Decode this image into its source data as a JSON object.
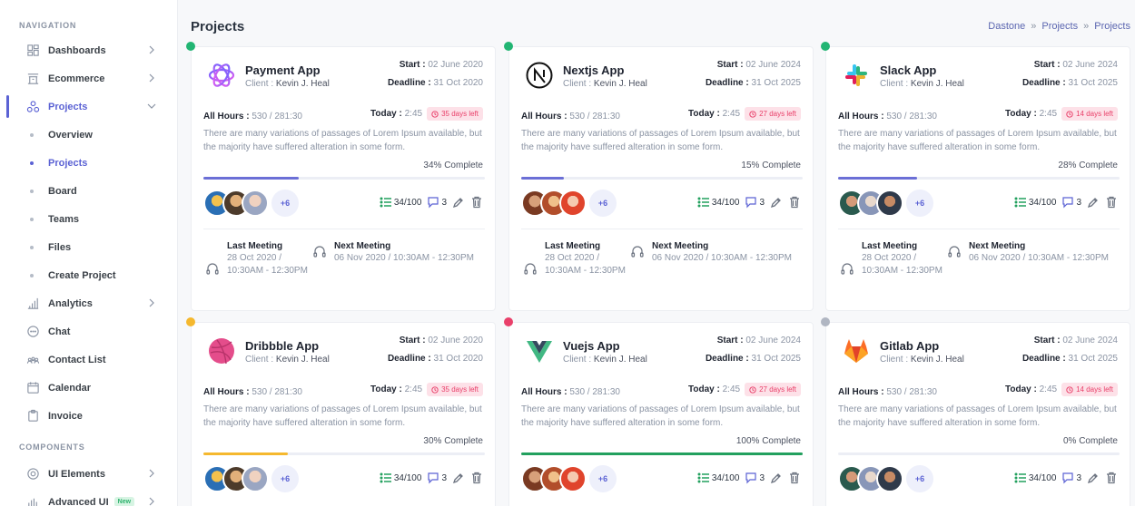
{
  "sidebar": {
    "navigation_title": "NAVIGATION",
    "components_title": "COMPONENTS",
    "items": [
      {
        "label": "Dashboards",
        "icon": "grid-icon"
      },
      {
        "label": "Ecommerce",
        "icon": "store-icon"
      },
      {
        "label": "Projects",
        "icon": "projects-icon"
      },
      {
        "label": "Analytics",
        "icon": "bar-chart-icon"
      },
      {
        "label": "Chat",
        "icon": "chat-icon"
      },
      {
        "label": "Contact List",
        "icon": "users-icon"
      },
      {
        "label": "Calendar",
        "icon": "calendar-icon"
      },
      {
        "label": "Invoice",
        "icon": "clipboard-icon"
      }
    ],
    "project_sub": [
      "Overview",
      "Projects",
      "Board",
      "Teams",
      "Files",
      "Create Project"
    ],
    "components": [
      {
        "label": "UI Elements",
        "icon": "ui-icon"
      },
      {
        "label": "Advanced UI",
        "icon": "advanced-icon",
        "badge": "New"
      }
    ]
  },
  "header": {
    "title": "Projects",
    "breadcrumb": [
      "Dastone",
      "Projects",
      "Projects"
    ]
  },
  "labels": {
    "start": "Start :",
    "deadline": "Deadline :",
    "client": "Client :",
    "all_hours": "All Hours :",
    "today": "Today :",
    "last_meeting": "Last Meeting",
    "next_meeting": "Next Meeting"
  },
  "projects": [
    {
      "name": "Payment App",
      "client": "Kevin J. Heal",
      "start": "02 June 2020",
      "deadline": "31 Oct 2020",
      "hours": "530 / 281:30",
      "today": "2:45",
      "days_left": "35 days left",
      "desc": "There are many variations of passages of Lorem Ipsum available, but the majority have suffered alteration in some form.",
      "complete": "34% Complete",
      "progress": 0.34,
      "progress_color": "#6b6fd6",
      "status_color": "#22b573",
      "more": "+6",
      "tasks": "34/100",
      "comments": "3",
      "last_meeting": "28 Oct 2020 / 10:30AM - 12:30PM",
      "next_meeting": "06 Nov 2020 / 10:30AM - 12:30PM",
      "logo": "payment-logo"
    },
    {
      "name": "Nextjs App",
      "client": "Kevin J. Heal",
      "start": "02 June 2024",
      "deadline": "31 Oct 2025",
      "hours": "530 / 281:30",
      "today": "2:45",
      "days_left": "27 days left",
      "desc": "There are many variations of passages of Lorem Ipsum available, but the majority have suffered alteration in some form.",
      "complete": "15% Complete",
      "progress": 0.15,
      "progress_color": "#6b6fd6",
      "status_color": "#22b573",
      "more": "+6",
      "tasks": "34/100",
      "comments": "3",
      "last_meeting": "28 Oct 2020 / 10:30AM - 12:30PM",
      "next_meeting": "06 Nov 2020 / 10:30AM - 12:30PM",
      "logo": "nextjs-logo"
    },
    {
      "name": "Slack App",
      "client": "Kevin J. Heal",
      "start": "02 June 2024",
      "deadline": "31 Oct 2025",
      "hours": "530 / 281:30",
      "today": "2:45",
      "days_left": "14 days left",
      "desc": "There are many variations of passages of Lorem Ipsum available, but the majority have suffered alteration in some form.",
      "complete": "28% Complete",
      "progress": 0.28,
      "progress_color": "#6b6fd6",
      "status_color": "#22b573",
      "more": "+6",
      "tasks": "34/100",
      "comments": "3",
      "last_meeting": "28 Oct 2020 / 10:30AM - 12:30PM",
      "next_meeting": "06 Nov 2020 / 10:30AM - 12:30PM",
      "logo": "slack-logo"
    },
    {
      "name": "Dribbble App",
      "client": "Kevin J. Heal",
      "start": "02 June 2020",
      "deadline": "31 Oct 2020",
      "hours": "530 / 281:30",
      "today": "2:45",
      "days_left": "35 days left",
      "desc": "There are many variations of passages of Lorem Ipsum available, but the majority have suffered alteration in some form.",
      "complete": "30% Complete",
      "progress": 0.3,
      "progress_color": "#f5b82e",
      "status_color": "#f5b82e",
      "more": "+6",
      "tasks": "34/100",
      "comments": "3",
      "logo": "dribbble-logo"
    },
    {
      "name": "Vuejs App",
      "client": "Kevin J. Heal",
      "start": "02 June 2024",
      "deadline": "31 Oct 2025",
      "hours": "530 / 281:30",
      "today": "2:45",
      "days_left": "27 days left",
      "desc": "There are many variations of passages of Lorem Ipsum available, but the majority have suffered alteration in some form.",
      "complete": "100% Complete",
      "progress": 1.0,
      "progress_color": "#22a05e",
      "status_color": "#e9406a",
      "more": "+6",
      "tasks": "34/100",
      "comments": "3",
      "logo": "vue-logo"
    },
    {
      "name": "Gitlab App",
      "client": "Kevin J. Heal",
      "start": "02 June 2024",
      "deadline": "31 Oct 2025",
      "hours": "530 / 281:30",
      "today": "2:45",
      "days_left": "14 days left",
      "desc": "There are many variations of passages of Lorem Ipsum available, but the majority have suffered alteration in some form.",
      "complete": "0% Complete",
      "progress": 0.0,
      "progress_color": "#6b6fd6",
      "status_color": "#b0b6c2",
      "more": "+6",
      "tasks": "34/100",
      "comments": "3",
      "logo": "gitlab-logo"
    }
  ]
}
